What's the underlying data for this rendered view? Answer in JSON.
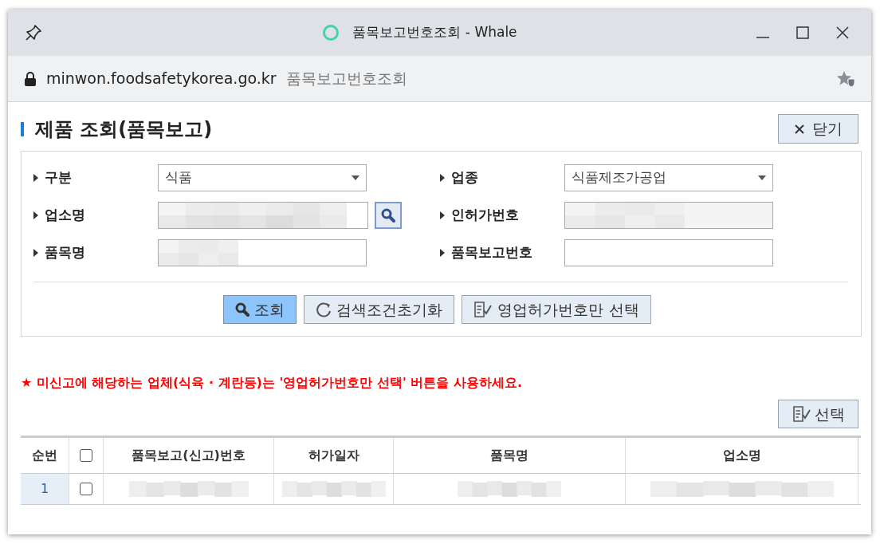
{
  "window": {
    "title": "품목보고번호조회 - Whale"
  },
  "address_bar": {
    "url": "minwon.foodsafetykorea.go.kr",
    "page_title": "품목보고번호조회"
  },
  "page": {
    "heading": "제품 조회(품목보고)",
    "close_button": "닫기"
  },
  "form": {
    "left": [
      {
        "label": "구분",
        "kind": "select",
        "value": "식품"
      },
      {
        "label": "업소명",
        "kind": "search",
        "redacted": true
      },
      {
        "label": "품목명",
        "kind": "input",
        "redacted": true
      }
    ],
    "right": [
      {
        "label": "업종",
        "kind": "select",
        "value": "식품제조가공업"
      },
      {
        "label": "인허가번호",
        "kind": "readonly",
        "redacted": true
      },
      {
        "label": "품목보고번호",
        "kind": "input",
        "redacted": false
      }
    ]
  },
  "buttons": [
    {
      "label": "조회",
      "kind": "search",
      "primary": true
    },
    {
      "label": "검색조건초기화",
      "kind": "reset",
      "primary": false
    },
    {
      "label": "영업허가번호만 선택",
      "kind": "pick",
      "primary": false
    }
  ],
  "notice": "★ 미신고에 해당하는 업체(식육 · 계란등)는 '영업허가번호만 선택' 버튼을 사용하세요.",
  "select_button": "선택",
  "table": {
    "columns": [
      {
        "kind": "text",
        "label": "순번"
      },
      {
        "kind": "checkbox",
        "checked": false
      },
      {
        "kind": "text",
        "label": "품목보고(신고)번호"
      },
      {
        "kind": "text",
        "label": "허가일자"
      },
      {
        "kind": "text",
        "label": "품목명"
      },
      {
        "kind": "text",
        "label": "업소명"
      }
    ],
    "rows": [
      {
        "number": "1",
        "checked": false
      }
    ]
  }
}
